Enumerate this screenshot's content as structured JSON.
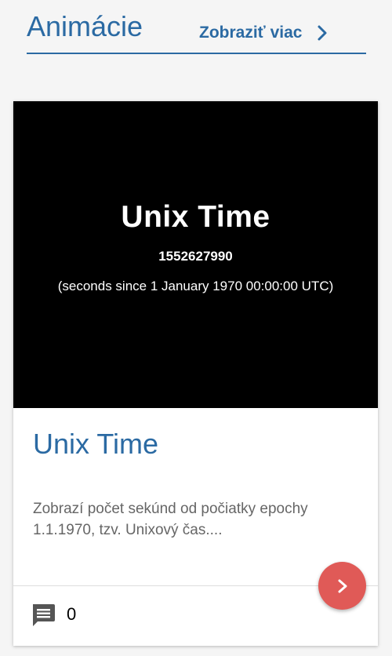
{
  "header": {
    "title": "Animácie",
    "see_more_label": "Zobraziť viac",
    "see_more_icon": "chevron-right-icon"
  },
  "card": {
    "thumbnail": {
      "title": "Unix Time",
      "number": "1552627990",
      "caption": "(seconds since 1 January 1970 00:00:00 UTC)"
    },
    "title": "Unix Time",
    "description": "Zobrazí počet sekúnd od počiatky epochy 1.1.1970, tzv. Unixový čas....",
    "comments_icon": "comment-icon",
    "comment_count": "0",
    "action_icon": "chevron-right-icon"
  },
  "colors": {
    "accent": "#2b6aa3",
    "fab": "#e05a57",
    "thumbnail_bg": "#000000"
  }
}
